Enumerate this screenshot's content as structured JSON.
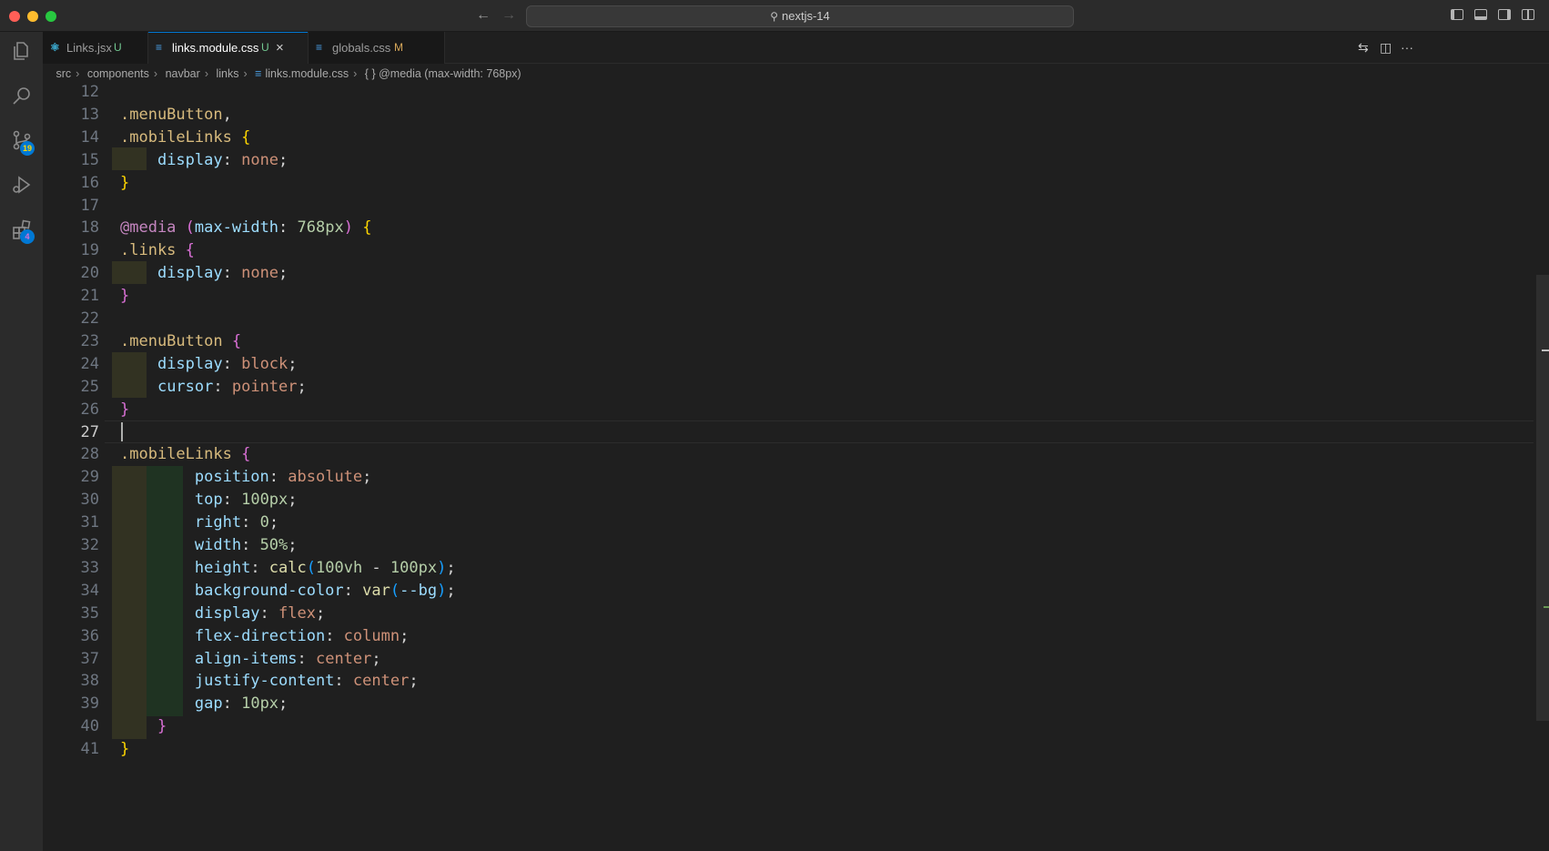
{
  "window": {
    "title": "nextjs-14"
  },
  "activity_bar": {
    "items": [
      {
        "icon": "explorer-icon"
      },
      {
        "icon": "search-icon"
      },
      {
        "icon": "source-control-icon",
        "badge": "19"
      },
      {
        "icon": "run-debug-icon"
      },
      {
        "icon": "extensions-icon",
        "badge": "4"
      }
    ]
  },
  "tabs": [
    {
      "label": "Links.jsx",
      "status": "U",
      "icon": "react-icon",
      "active": false
    },
    {
      "label": "links.module.css",
      "status": "U",
      "icon": "css-icon",
      "active": true
    },
    {
      "label": "globals.css",
      "status": "M",
      "icon": "css-icon",
      "active": false
    }
  ],
  "breadcrumbs": [
    "src",
    "components",
    "navbar",
    "links",
    "links.module.css",
    "{ } @media (max-width: 768px)"
  ],
  "editor": {
    "active_line": "27",
    "lines": [
      {
        "n": "12",
        "t": ""
      },
      {
        "n": "13",
        "t": ".menuButton,"
      },
      {
        "n": "14",
        "t": ".mobileLinks {"
      },
      {
        "n": "15",
        "t": "    display: none;"
      },
      {
        "n": "16",
        "t": "}"
      },
      {
        "n": "17",
        "t": ""
      },
      {
        "n": "18",
        "t": "@media (max-width: 768px) {"
      },
      {
        "n": "19",
        "t": ".links {"
      },
      {
        "n": "20",
        "t": "    display: none;"
      },
      {
        "n": "21",
        "t": "}"
      },
      {
        "n": "22",
        "t": ""
      },
      {
        "n": "23",
        "t": ".menuButton {"
      },
      {
        "n": "24",
        "t": "    display: block;"
      },
      {
        "n": "25",
        "t": "    cursor: pointer;"
      },
      {
        "n": "26",
        "t": "}"
      },
      {
        "n": "27",
        "t": ""
      },
      {
        "n": "28",
        "t": ".mobileLinks {"
      },
      {
        "n": "29",
        "t": "        position: absolute;"
      },
      {
        "n": "30",
        "t": "        top: 100px;"
      },
      {
        "n": "31",
        "t": "        right: 0;"
      },
      {
        "n": "32",
        "t": "        width: 50%;"
      },
      {
        "n": "33",
        "t": "        height: calc(100vh - 100px);"
      },
      {
        "n": "34",
        "t": "        background-color: var(--bg);"
      },
      {
        "n": "35",
        "t": "        display: flex;"
      },
      {
        "n": "36",
        "t": "        flex-direction: column;"
      },
      {
        "n": "37",
        "t": "        align-items: center;"
      },
      {
        "n": "38",
        "t": "        justify-content: center;"
      },
      {
        "n": "39",
        "t": "        gap: 10px;"
      },
      {
        "n": "40",
        "t": "    }"
      },
      {
        "n": "41",
        "t": "}"
      }
    ]
  },
  "colors": {
    "background": "#1f1f1f",
    "accent": "#0078d4",
    "selector": "#d7ba7d",
    "property": "#9cdcfe",
    "value": "#ce9178",
    "number": "#b5cea8"
  }
}
